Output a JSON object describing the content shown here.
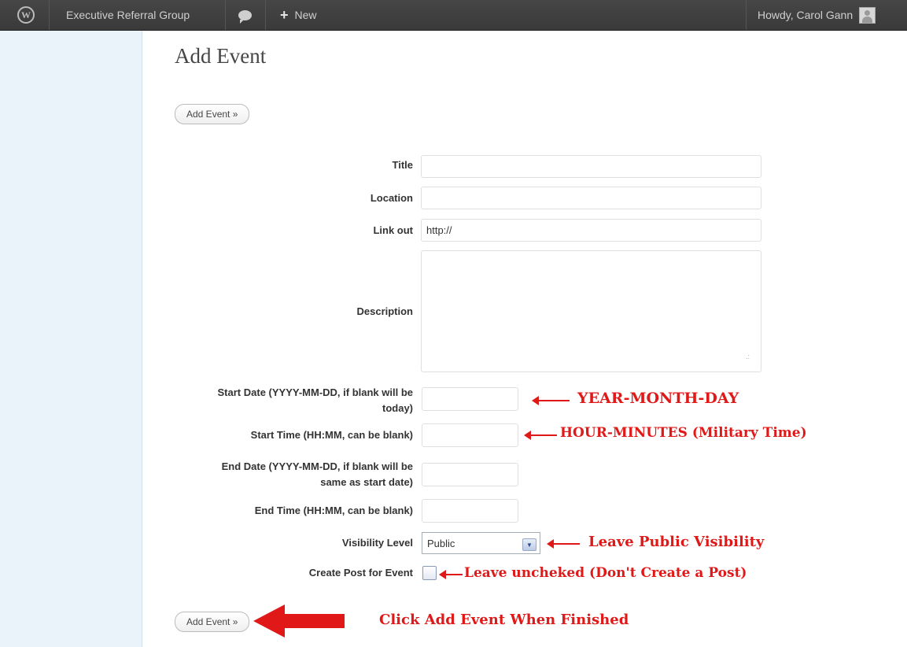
{
  "admin_bar": {
    "site_name": "Executive Referral Group",
    "new_label": "New",
    "greeting": "Howdy, Carol Gann",
    "logo_letter": "W"
  },
  "page": {
    "title": "Add Event",
    "top_button": "Add Event »",
    "bottom_button": "Add Event »"
  },
  "form": {
    "title_label": "Title",
    "location_label": "Location",
    "link_label": "Link out",
    "link_value": "http://",
    "description_label": "Description",
    "start_date_label_line1": "Start Date (YYYY-MM-DD, if blank will be",
    "start_date_label_line2": "today)",
    "start_time_label": "Start Time (HH:MM, can be blank)",
    "end_date_label_line1": "End Date (YYYY-MM-DD, if blank will be",
    "end_date_label_line2": "same as start date)",
    "end_time_label": "End Time (HH:MM, can be blank)",
    "visibility_label": "Visibility Level",
    "visibility_value": "Public",
    "create_post_label": "Create Post for Event",
    "create_post_checked": false
  },
  "annotations": {
    "date": "YEAR-MONTH-DAY",
    "time": "HOUR-MINUTES (Military Time)",
    "visibility": "Leave Public Visibility",
    "post": "Leave uncheked (Don't Create a Post)",
    "finish": "Click Add Event When Finished"
  },
  "colors": {
    "annotation": "#e01818",
    "admin_bar": "#464646",
    "side_menu": "#eaf2fa"
  }
}
